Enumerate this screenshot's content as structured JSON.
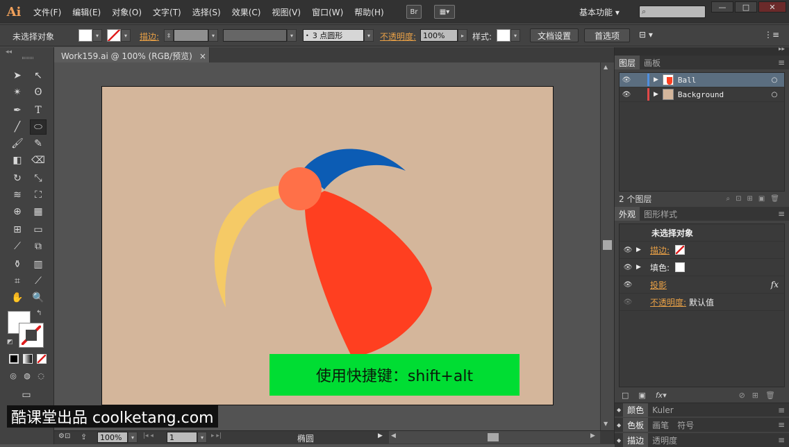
{
  "app": {
    "logo": "Ai"
  },
  "menu": [
    "文件(F)",
    "编辑(E)",
    "对象(O)",
    "文字(T)",
    "选择(S)",
    "效果(C)",
    "视图(V)",
    "窗口(W)",
    "帮助(H)"
  ],
  "menubar_extra": {
    "bridge": "Br",
    "workspace": "基本功能"
  },
  "window_buttons": {
    "minimize": "—",
    "maximize": "□",
    "close": "✕"
  },
  "control": {
    "selection_status": "未选择对象",
    "stroke_label": "描边:",
    "stroke_profile": "3 点圆形",
    "opacity_label": "不透明度:",
    "opacity_value": "100%",
    "style_label": "样式:",
    "doc_setup": "文档设置",
    "preferences": "首选项"
  },
  "document": {
    "tab_title": "Work159.ai @ 100% (RGB/预览)",
    "tab_close": "×"
  },
  "caption": "使用快捷键：shift+alt",
  "watermark": "酷课堂出品 coolketang.com",
  "status": {
    "zoom": "100%",
    "page": "1",
    "tool_name": "椭圆"
  },
  "layers_panel": {
    "tabs": [
      "图层",
      "画板"
    ],
    "layers": [
      {
        "name": "Ball",
        "color": "#4f8fdf"
      },
      {
        "name": "Background",
        "color": "#e04848"
      }
    ],
    "footer": "2 个图层"
  },
  "appearance_panel": {
    "tabs": [
      "外观",
      "图形样式"
    ],
    "header": "未选择对象",
    "rows": [
      {
        "label": "描边:",
        "orange": true
      },
      {
        "label": "填色:",
        "orange": false
      },
      {
        "label": "投影",
        "orange": true,
        "fx": "fx"
      },
      {
        "label": "不透明度:",
        "orange": true,
        "value": "默认值"
      }
    ]
  },
  "collapsed_panels": [
    {
      "tabs": [
        "颜色",
        "Kuler"
      ]
    },
    {
      "tabs": [
        "色板",
        "画笔",
        "符号"
      ]
    },
    {
      "tabs": [
        "描边",
        "透明度"
      ]
    }
  ],
  "colors": {
    "artboard": "#d4b69b",
    "blue_panel": "#0c5cb4",
    "yellow_panel": "#f5ca66",
    "red_panel": "#ff3f20",
    "cap": "#ff7048",
    "caption_bg": "#00dd33"
  }
}
